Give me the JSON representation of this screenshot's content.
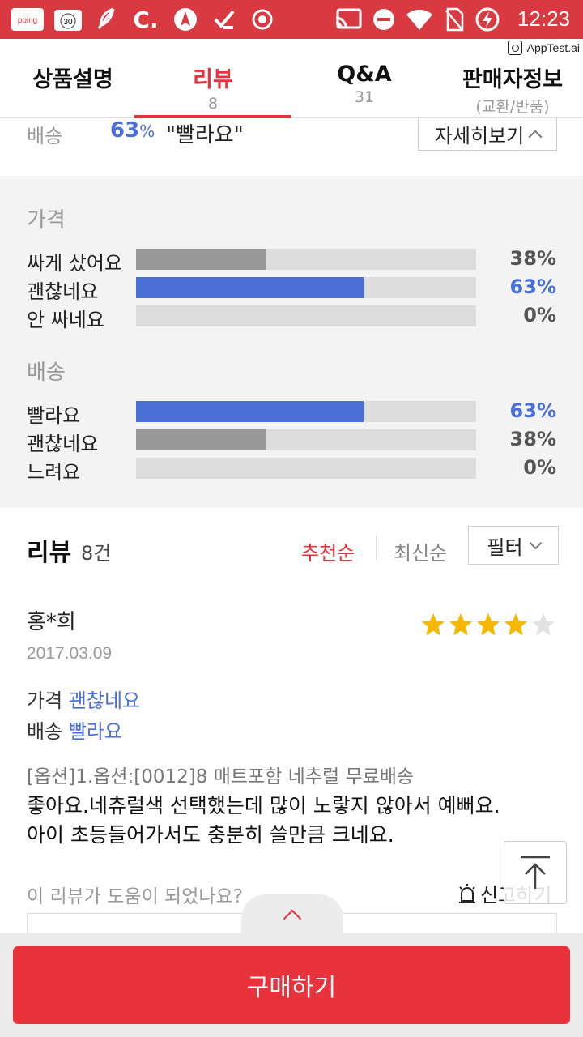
{
  "status_bar": {
    "time": "12:23",
    "badge_count": "30",
    "icons": [
      "poing-app-icon",
      "calendar-icon",
      "feather-icon",
      "c-app-icon",
      "compass-icon",
      "check-icon",
      "record-icon",
      "cast-icon",
      "dnd-icon",
      "wifi-icon",
      "no-sim-icon",
      "battery-charging-icon"
    ]
  },
  "apptest": "AppTest.ai",
  "tabs": [
    {
      "label": "상품설명",
      "sub": ""
    },
    {
      "label": "리뷰",
      "sub": "8"
    },
    {
      "label": "Q&A",
      "sub": "31"
    },
    {
      "label": "판매자정보",
      "sub": "(교환/반품)"
    }
  ],
  "summary": {
    "label": "배송",
    "pct": "63",
    "pct_unit": "%",
    "value": "\"빨라요\"",
    "detail_button": "자세히보기"
  },
  "ratings": {
    "groups": [
      {
        "title": "가격",
        "rows": [
          {
            "name": "싸게 샀어요",
            "pct": "38%",
            "fraction": 0.38,
            "highlight": false
          },
          {
            "name": "괜찮네요",
            "pct": "63%",
            "fraction": 0.67,
            "highlight": true
          },
          {
            "name": "안 싸네요",
            "pct": "0%",
            "fraction": 0,
            "highlight": false
          }
        ]
      },
      {
        "title": "배송",
        "rows": [
          {
            "name": "빨라요",
            "pct": "63%",
            "fraction": 0.67,
            "highlight": true
          },
          {
            "name": "괜찮네요",
            "pct": "38%",
            "fraction": 0.38,
            "highlight": false
          },
          {
            "name": "느려요",
            "pct": "0%",
            "fraction": 0,
            "highlight": false
          }
        ]
      }
    ]
  },
  "review_header": {
    "title": "리뷰",
    "count": "8건",
    "sort_recommended": "추천순",
    "sort_latest": "최신순",
    "filter": "필터"
  },
  "review": {
    "author": "홍*희",
    "date": "2017.03.09",
    "rating": 4,
    "price_label": "가격",
    "price_value": "괜찮네요",
    "delivery_label": "배송",
    "delivery_value": "빨라요",
    "option": "[옵션]1.옵션:[0012]8 매트포함 네추럴 무료배송",
    "body_line1": "좋아요.네츄럴색 선택했는데 많이 노랗지 않아서 예뻐요.",
    "body_line2": "아이 초등들어가서도 충분히 쓸만큼 크네요.",
    "helpful_question": "이 리뷰가 도움이 되었나요?",
    "report": "신고하기"
  },
  "buy_button": "구매하기",
  "colors": {
    "accent": "#e8323c",
    "blue": "#4a6fd6",
    "star": "#f5b800"
  }
}
